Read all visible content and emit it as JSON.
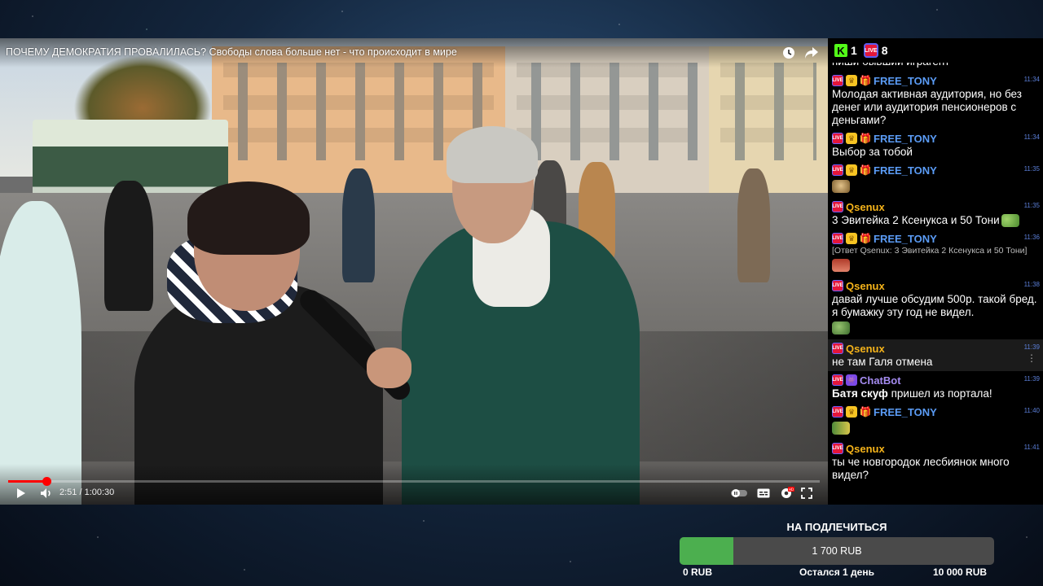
{
  "video": {
    "title": "ПОЧЕМУ ДЕМОКРАТИЯ ПРОВАЛИЛАСЬ? Свободы слова больше нет - что происходит в мире",
    "current_time": "2:51",
    "duration": "1:00:30",
    "time_display": "2:51 / 1:00:30",
    "progress_fraction": 0.047
  },
  "platforms": {
    "kick": {
      "logo": "K",
      "viewers": "1"
    },
    "vk": {
      "logo": "LIVE",
      "viewers": "8"
    }
  },
  "chat": {
    "top_fragment": "пиши бывший играгент",
    "messages": [
      {
        "platform": "LIVE",
        "badges": [
          "crown",
          "gift"
        ],
        "nick": "FREE_TONY",
        "nick_color": "#5b9cf6",
        "time": "11:34",
        "text": "Молодая активная аудитория, но без денег или аудитория пенсионеров с деньгами?"
      },
      {
        "platform": "LIVE",
        "badges": [
          "crown",
          "gift"
        ],
        "nick": "FREE_TONY",
        "nick_color": "#5b9cf6",
        "time": "11:34",
        "text": "Выбор за тобой"
      },
      {
        "platform": "LIVE",
        "badges": [
          "crown",
          "gift"
        ],
        "nick": "FREE_TONY",
        "nick_color": "#5b9cf6",
        "time": "11:35",
        "text": "",
        "emote": "dog"
      },
      {
        "platform": "LIVE",
        "badges": [],
        "nick": "Qsenux",
        "nick_color": "#f5b31a",
        "time": "11:35",
        "text": "3 Эвитейка 2 Ксенукса и 50 Тони",
        "emote_after": "frog"
      },
      {
        "platform": "LIVE",
        "badges": [
          "crown",
          "gift"
        ],
        "nick": "FREE_TONY",
        "nick_color": "#5b9cf6",
        "time": "11:36",
        "reply": "[Ответ Qsenux: 3 Эвитейка 2 Ксенукса и 50 Тони]",
        "emote": "girl"
      },
      {
        "platform": "LIVE",
        "badges": [],
        "nick": "Qsenux",
        "nick_color": "#f5b31a",
        "time": "11:38",
        "text": "давай лучше обсудим 500р. такой бред. я бумажку эту год не видел.",
        "emote_line": "pepe"
      },
      {
        "platform": "LIVE",
        "badges": [],
        "nick": "Qsenux",
        "nick_color": "#f5b31a",
        "time": "11:39",
        "text": "не там Галя отмена",
        "highlight": true
      },
      {
        "platform": "LIVE",
        "badges": [
          "bot"
        ],
        "nick": "ChatBot",
        "nick_color": "#a48bf0",
        "time": "11:39",
        "bold_part": "Батя скуф",
        "text": " пришел из портала!"
      },
      {
        "platform": "LIVE",
        "badges": [
          "crown",
          "gift"
        ],
        "nick": "FREE_TONY",
        "nick_color": "#5b9cf6",
        "time": "11:40",
        "text": "",
        "emote": "rich"
      },
      {
        "platform": "LIVE",
        "badges": [],
        "nick": "Qsenux",
        "nick_color": "#f5b31a",
        "time": "11:41",
        "text": "ты че новгородок лесбиянок много видел?"
      }
    ]
  },
  "goal": {
    "title": "НА ПОДЛЕЧИТЬСЯ",
    "current": "1 700 RUB",
    "min": "0 RUB",
    "max": "10 000 RUB",
    "remaining": "Остался 1 день",
    "fill_fraction": 0.17,
    "fill_color": "#4caf4f"
  },
  "colors": {
    "accent_red": "#ff0000",
    "kick_green": "#53fc18",
    "vk_red": "#e4163a"
  },
  "icons": {
    "clock": "watch-later-icon",
    "share": "share-icon",
    "play": "play-icon",
    "volume": "volume-icon",
    "autoplay": "autoplay-toggle-icon",
    "cc": "subtitles-icon",
    "settings": "settings-gear-icon",
    "fullscreen": "fullscreen-icon"
  }
}
